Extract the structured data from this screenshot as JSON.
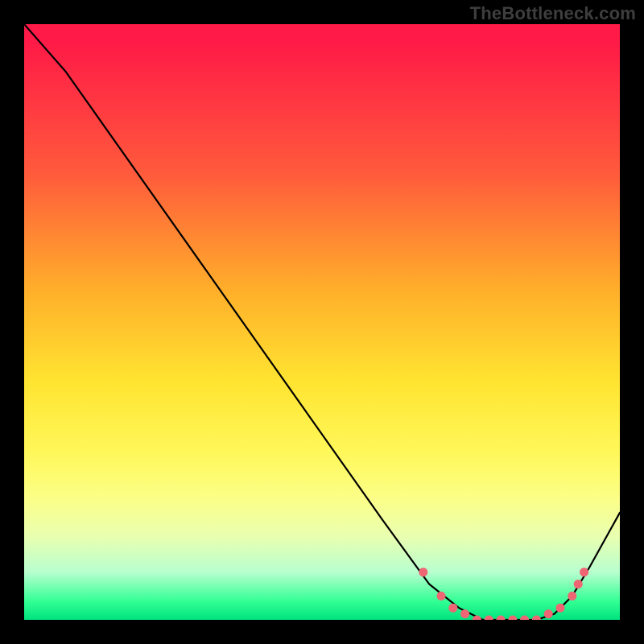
{
  "attribution": "TheBottleneck.com",
  "chart_data": {
    "type": "line",
    "title": "",
    "xlabel": "",
    "ylabel": "",
    "xlim": [
      0,
      100
    ],
    "ylim": [
      0,
      100
    ],
    "series": [
      {
        "name": "curve",
        "x": [
          0,
          7,
          60,
          68,
          73,
          77,
          80,
          83,
          86,
          89,
          92,
          95,
          100
        ],
        "y": [
          100,
          92,
          17,
          6,
          2,
          0,
          0,
          0,
          0,
          1,
          4,
          9,
          18
        ]
      }
    ],
    "markers": {
      "name": "highlight-points",
      "color": "#ee6674",
      "x": [
        67,
        70,
        72,
        74,
        76,
        78,
        80,
        82,
        84,
        86,
        88,
        90,
        92,
        93,
        94
      ],
      "y": [
        8,
        4,
        2,
        1,
        0,
        0,
        0,
        0,
        0,
        0,
        1,
        2,
        4,
        6,
        8
      ]
    },
    "gradient_stops": [
      {
        "pos": 0,
        "color": "#ff1a47"
      },
      {
        "pos": 25,
        "color": "#ff5a3c"
      },
      {
        "pos": 45,
        "color": "#ffb02a"
      },
      {
        "pos": 60,
        "color": "#ffe431"
      },
      {
        "pos": 80,
        "color": "#fbff8a"
      },
      {
        "pos": 92,
        "color": "#b8ffcf"
      },
      {
        "pos": 100,
        "color": "#00e27e"
      }
    ]
  }
}
